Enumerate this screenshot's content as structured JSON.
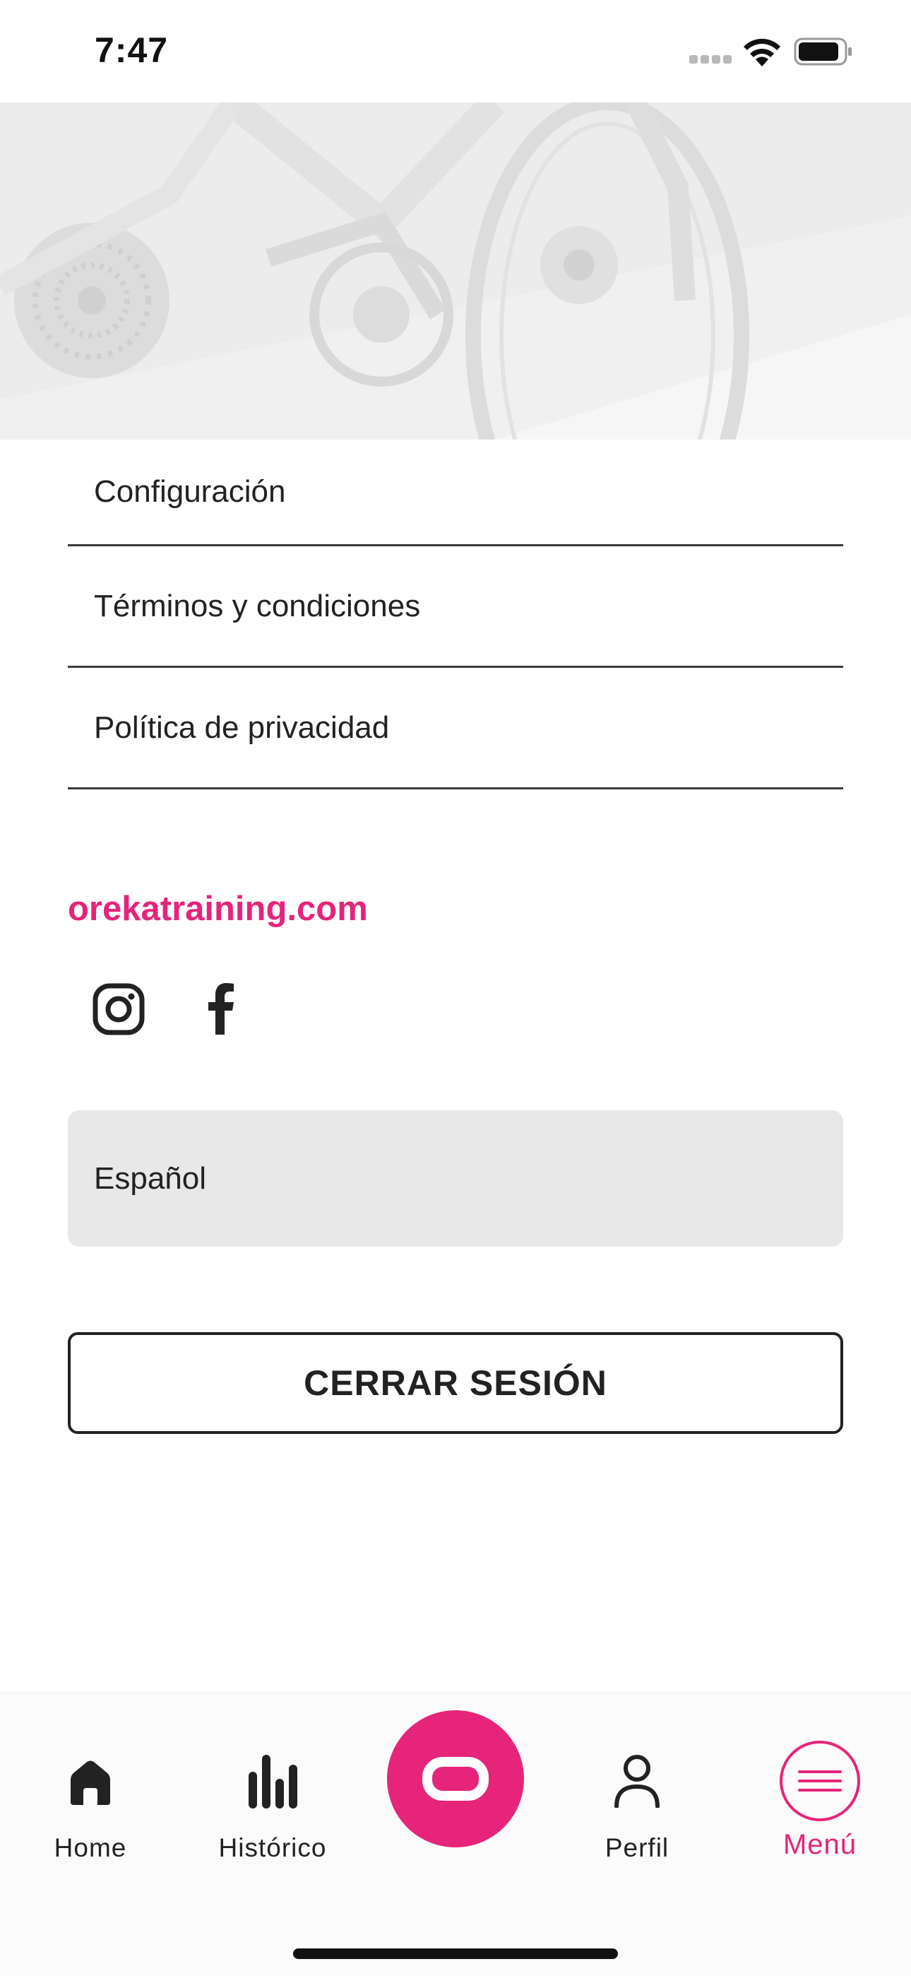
{
  "status_bar": {
    "time": "7:47"
  },
  "menu": {
    "items": [
      {
        "label": "Configuración"
      },
      {
        "label": "Términos y condiciones"
      },
      {
        "label": "Política de privacidad"
      }
    ]
  },
  "website": "orekatraining.com",
  "social": {
    "icons": [
      "instagram-icon",
      "facebook-icon"
    ]
  },
  "language": {
    "selected": "Español"
  },
  "logout_label": "CERRAR SESIÓN",
  "bottom_nav": {
    "items": [
      {
        "label": "Home",
        "icon": "home-icon"
      },
      {
        "label": "Histórico",
        "icon": "bar-chart-icon"
      },
      {
        "label": "",
        "icon": "oreka-logo-icon"
      },
      {
        "label": "Perfil",
        "icon": "person-icon"
      },
      {
        "label": "Menú",
        "icon": "hamburger-menu-icon",
        "active": true
      }
    ]
  },
  "colors": {
    "accent": "#e6247a",
    "text": "#222222",
    "field_bg": "#e8e8e8"
  }
}
